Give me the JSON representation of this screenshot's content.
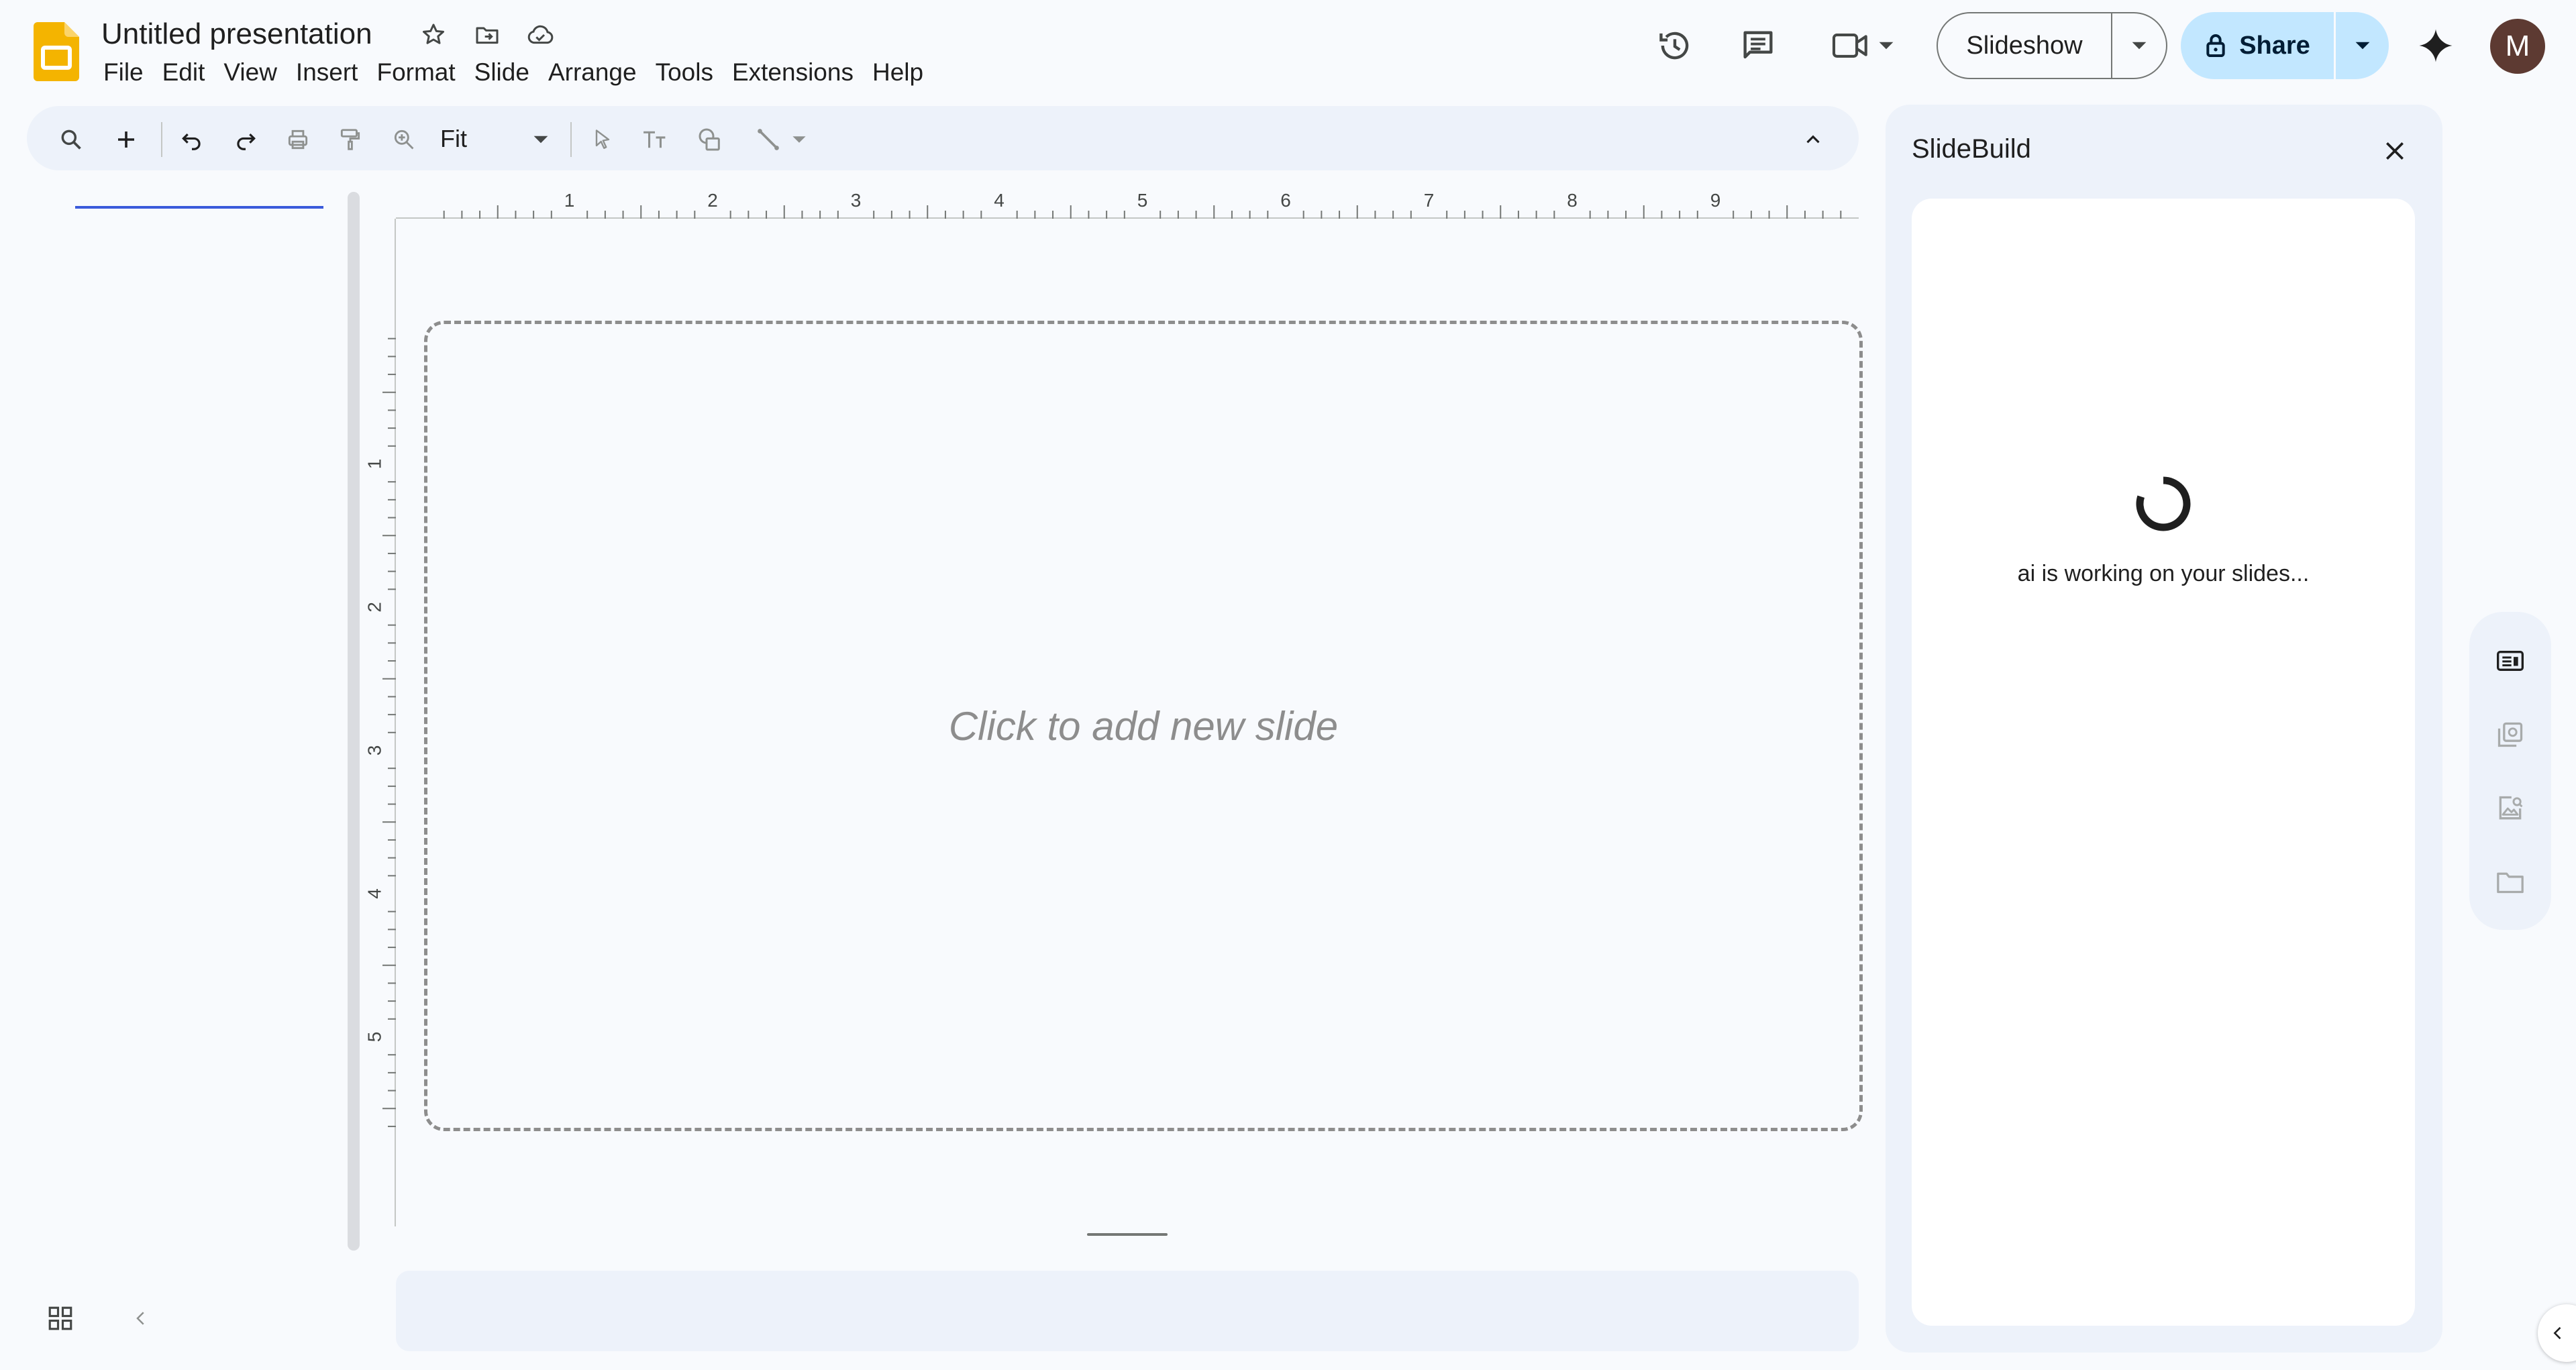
{
  "app": {
    "title": "Untitled presentation",
    "brand_color": "#f4b400"
  },
  "menu": [
    "File",
    "Edit",
    "View",
    "Insert",
    "Format",
    "Slide",
    "Arrange",
    "Tools",
    "Extensions",
    "Help"
  ],
  "header": {
    "slideshow_label": "Slideshow",
    "share_label": "Share",
    "avatar_initial": "M"
  },
  "toolbar": {
    "zoom_value": "Fit"
  },
  "rulers": {
    "horizontal_ticks": [
      "1",
      "2",
      "3",
      "4",
      "5",
      "6",
      "7",
      "8",
      "9"
    ],
    "vertical_ticks": [
      "1",
      "2",
      "3",
      "4",
      "5"
    ]
  },
  "canvas": {
    "placeholder_text": "Click to add new slide"
  },
  "side_panel": {
    "title": "SlideBuild",
    "status_text": "ai is working on your slides..."
  },
  "colors": {
    "accent": "#0b57d0",
    "share_bg": "#c2e7ff",
    "panel_bg": "#edf2fa"
  }
}
